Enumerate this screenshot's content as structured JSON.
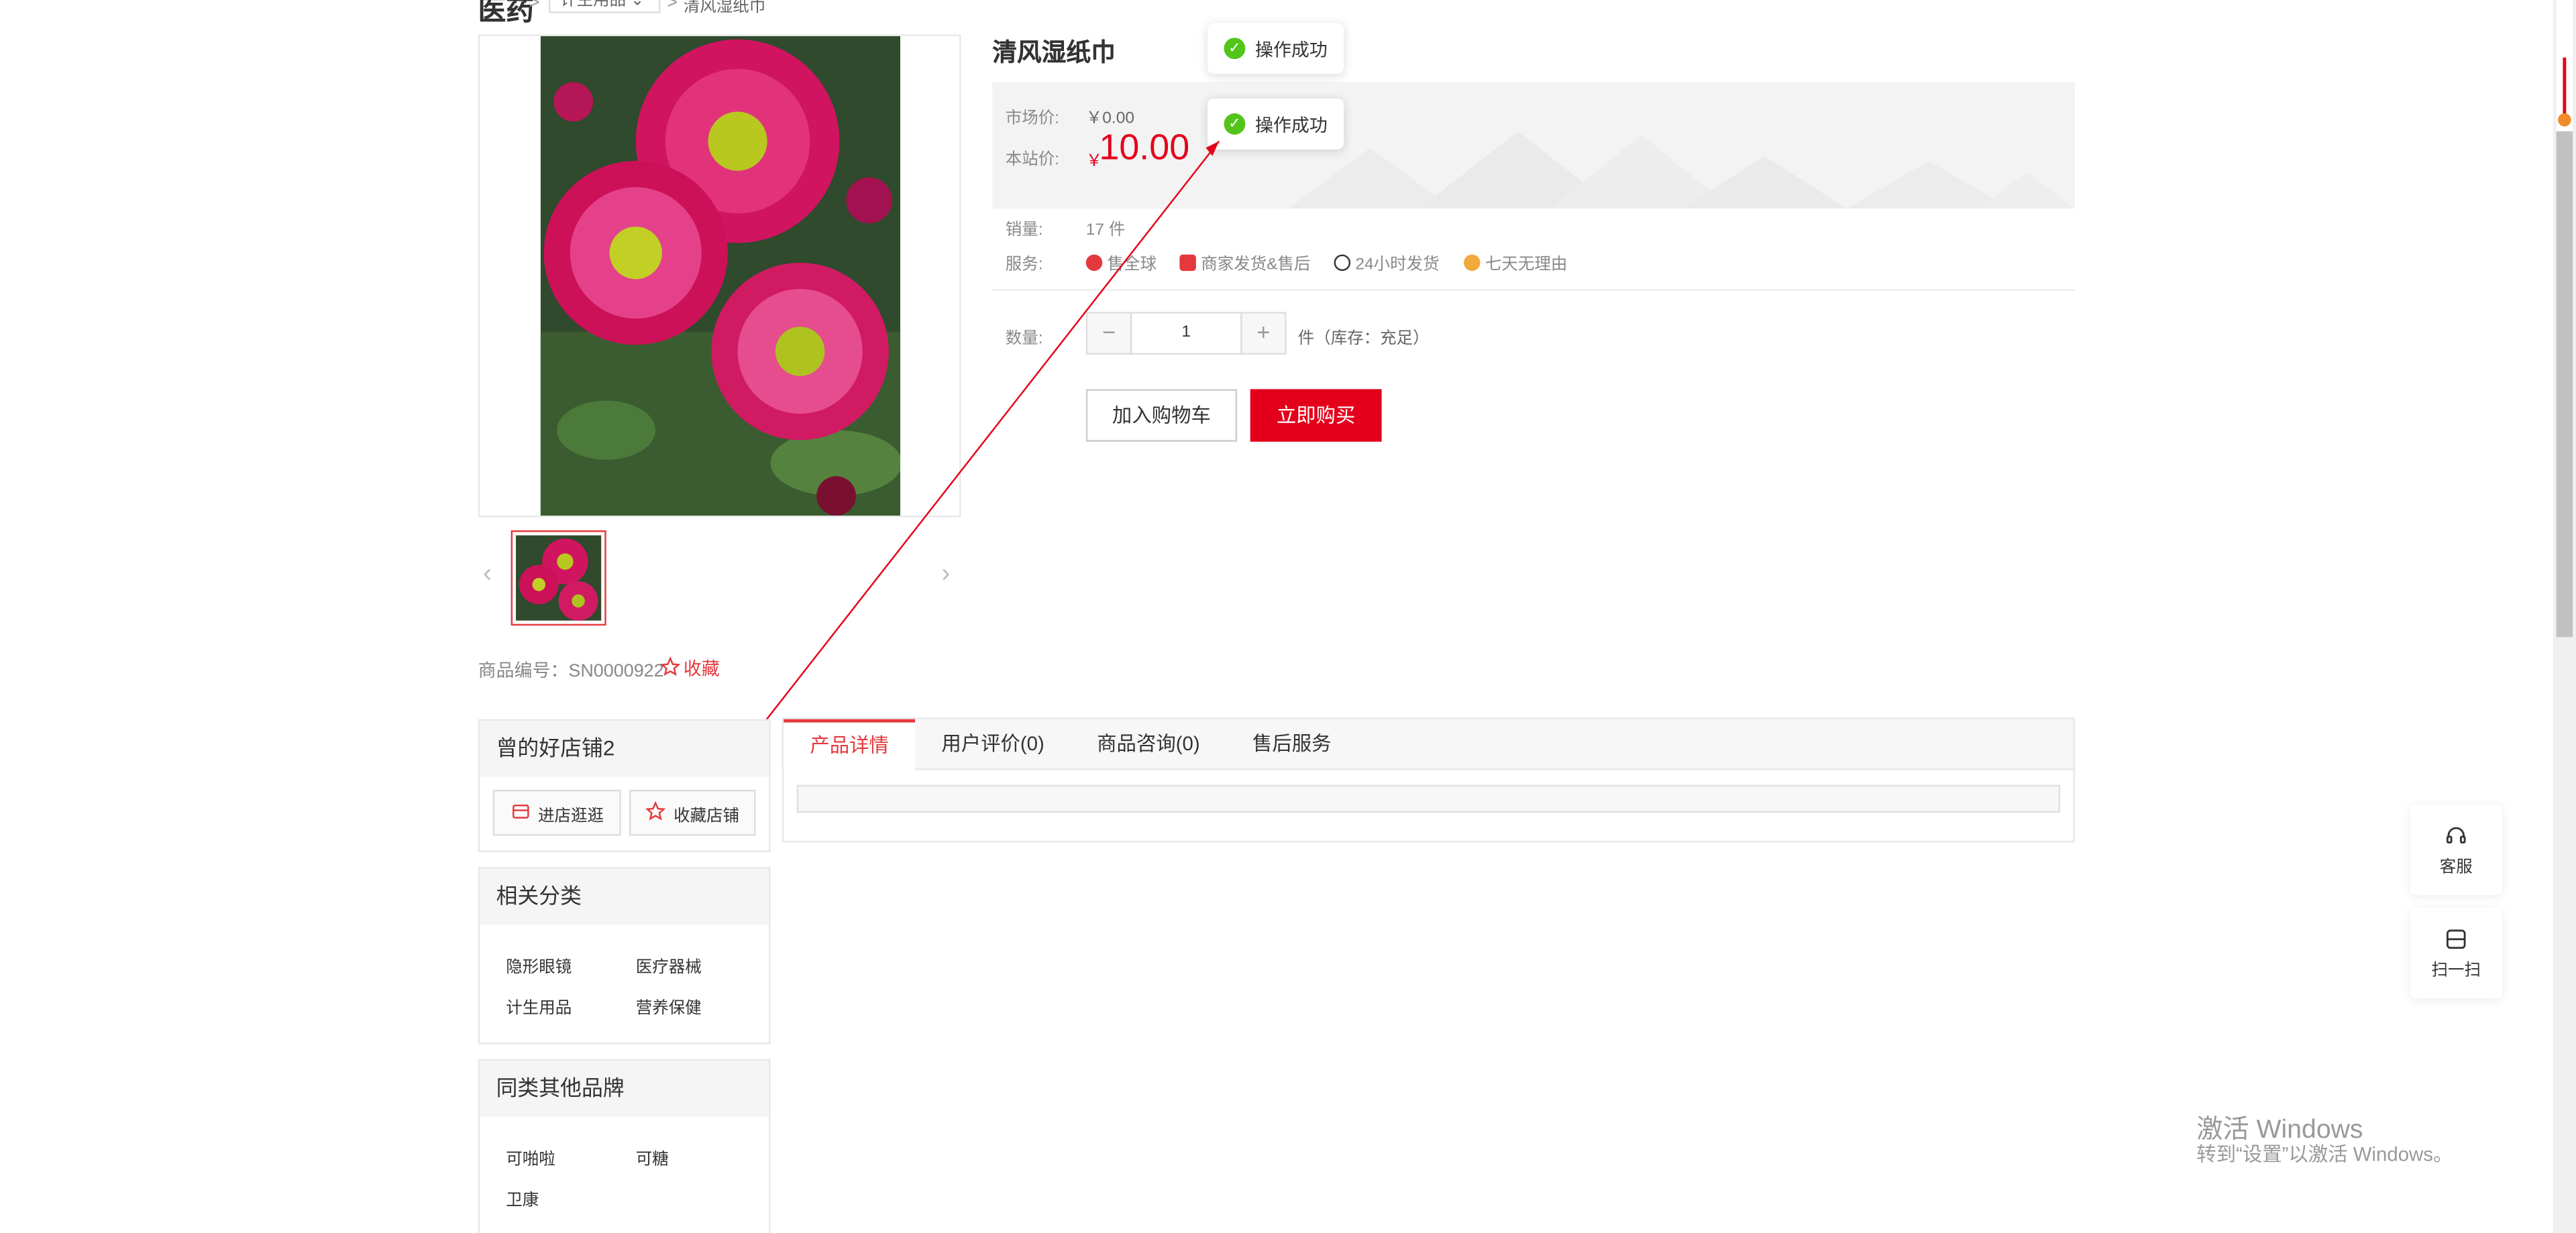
{
  "breadcrumb": {
    "root": "医药",
    "category": "计生用品",
    "current": "清风湿纸巾",
    "sep": ">",
    "chevron": "⌄"
  },
  "product": {
    "title": "清风湿纸巾",
    "market_price_label": "市场价:",
    "market_price": "￥0.00",
    "site_price_label": "本站价:",
    "yen": "￥",
    "site_price": "10.00",
    "sales_label": "销量:",
    "sales_value": "17 件",
    "service_label": "服务:",
    "services": [
      {
        "label": "售全球",
        "icon": "globe-icon"
      },
      {
        "label": "商家发货&售后",
        "icon": "truck-icon"
      },
      {
        "label": "24小时发货",
        "icon": "24h-icon"
      },
      {
        "label": "七天无理由",
        "icon": "seven-day-icon"
      }
    ],
    "qty_label": "数量:",
    "qty_value": "1",
    "qty_minus": "−",
    "qty_plus": "+",
    "qty_unit": "件（库存：充足）",
    "add_cart": "加入购物车",
    "buy_now": "立即购买",
    "sku_text": "商品编号：SN0000922",
    "fav_text": "收藏"
  },
  "gallery": {
    "prev": "‹",
    "next": "›"
  },
  "toasts": [
    {
      "text": "操作成功"
    },
    {
      "text": "操作成功"
    }
  ],
  "store": {
    "name": "曾的好店铺2",
    "enter_btn": "进店逛逛",
    "fav_btn": "收藏店铺"
  },
  "related": {
    "title": "相关分类",
    "items": [
      "隐形眼镜",
      "医疗器械",
      "计生用品",
      "营养保健"
    ]
  },
  "brands": {
    "title": "同类其他品牌",
    "items": [
      "可啪啦",
      "可糖",
      "卫康"
    ]
  },
  "tabs": [
    "产品详情",
    "用户评价(0)",
    "商品咨询(0)",
    "售后服务"
  ],
  "side_tools": [
    {
      "label": "客服",
      "icon": "headset-icon"
    },
    {
      "label": "扫一扫",
      "icon": "scan-icon"
    }
  ],
  "watermark": {
    "line1": "激活 Windows",
    "line2": "转到“设置”以激活 Windows。"
  },
  "colors": {
    "accent": "#e4001b",
    "success": "#52c41a"
  }
}
